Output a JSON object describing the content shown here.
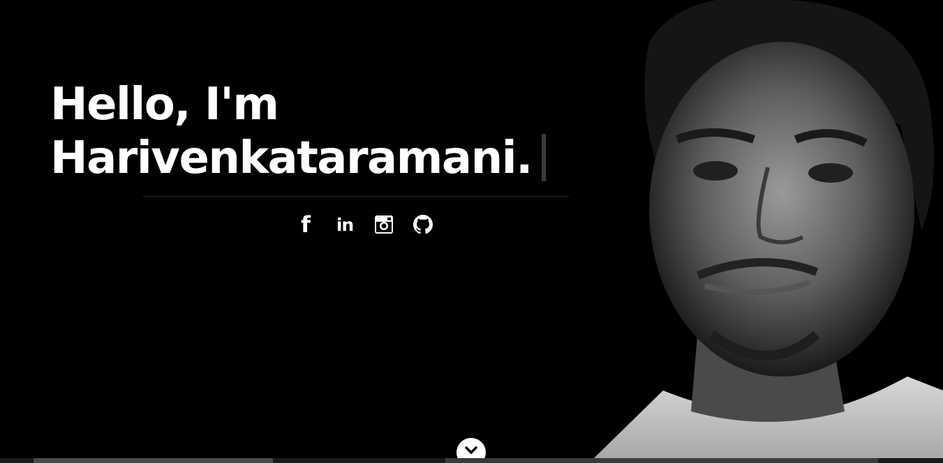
{
  "hero": {
    "greeting": "Hello, I'm",
    "name": "Harivenkataramani.",
    "portrait_alt": "portrait of Harivenkataramani"
  },
  "socials": [
    {
      "name": "facebook",
      "icon": "facebook-icon"
    },
    {
      "name": "linkedin",
      "icon": "linkedin-icon"
    },
    {
      "name": "instagram",
      "icon": "instagram-icon"
    },
    {
      "name": "github",
      "icon": "github-icon"
    }
  ],
  "scroll": {
    "icon": "chevron-down-icon"
  },
  "colors": {
    "background": "#000000",
    "text": "#ffffff",
    "cursor": "#3a3a3a"
  }
}
